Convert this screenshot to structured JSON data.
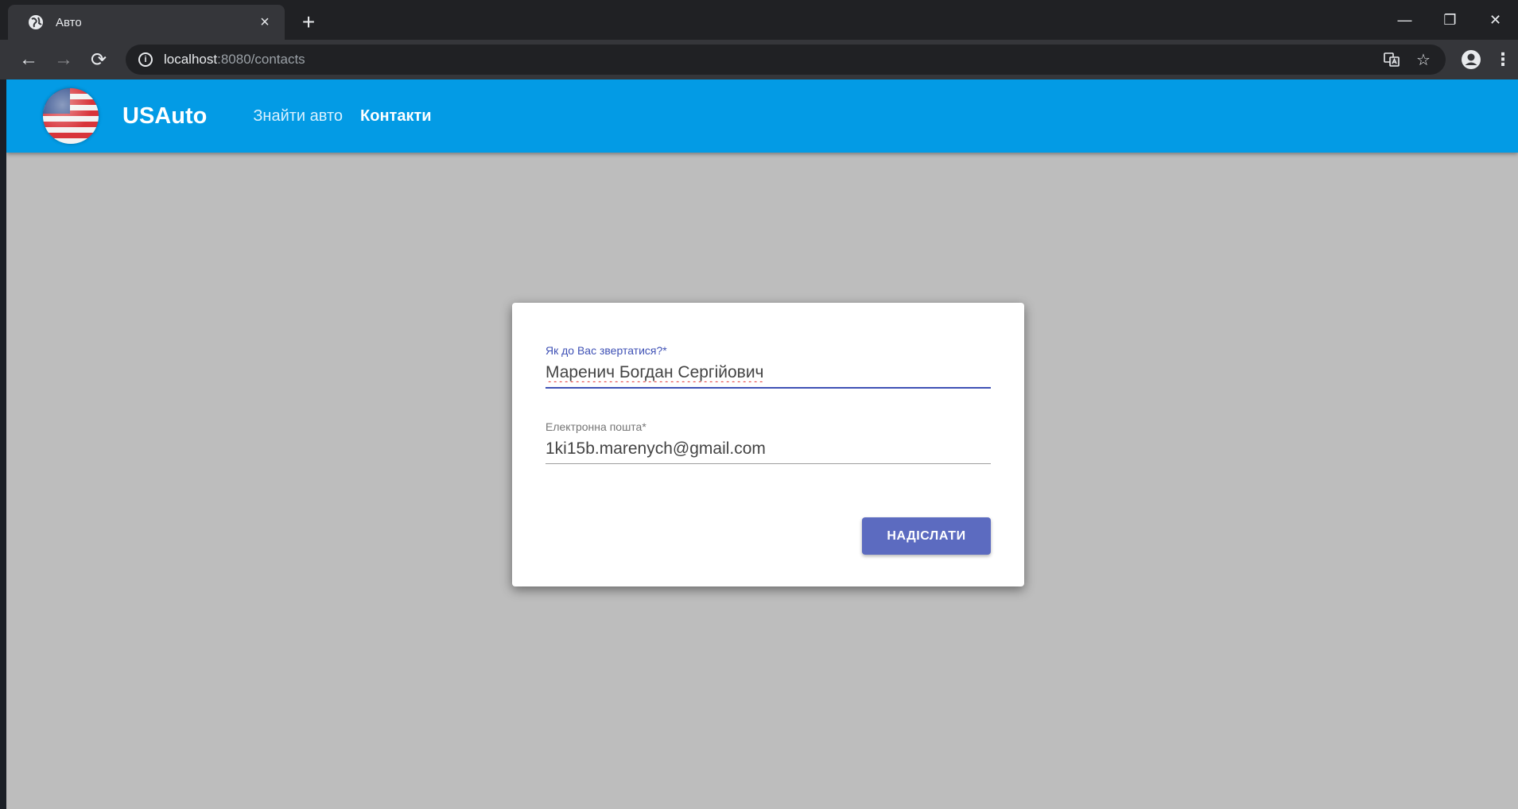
{
  "browser": {
    "tab": {
      "title": "Авто",
      "favicon": "globe-icon",
      "close_glyph": "×"
    },
    "new_tab_glyph": "+",
    "window_controls": {
      "minimize": "—",
      "restore": "❐",
      "close": "✕"
    },
    "nav": {
      "back": "←",
      "forward": "→",
      "reload": "⟳"
    },
    "address": {
      "host": "localhost",
      "rest": ":8080/contacts"
    },
    "omni_icons": {
      "translate": "translate-icon",
      "bookmark": "☆"
    },
    "menu_glyph": "⋮"
  },
  "app": {
    "brand": "USAuto",
    "nav": [
      {
        "label": "Знайти авто"
      },
      {
        "label": "Контакти"
      }
    ]
  },
  "form": {
    "name": {
      "label": "Як до Вас звертатися?*",
      "value": "Маренич Богдан Сергійович"
    },
    "email": {
      "label": "Електронна пошта*",
      "value": "1ki15b.marenych@gmail.com"
    },
    "submit_label": "НАДІСЛАТИ"
  },
  "colors": {
    "appbar": "#039be5",
    "primary": "#3f51b5",
    "button": "#5c6bc0"
  }
}
